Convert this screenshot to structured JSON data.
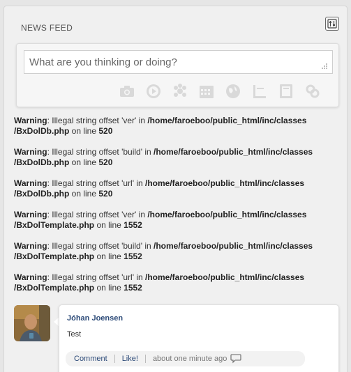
{
  "panel": {
    "title": "NEWS FEED",
    "settings_icon": "panel-settings-icon"
  },
  "composer": {
    "placeholder": "What are you thinking or doing?",
    "tools": [
      "camera-icon",
      "video-icon",
      "sound-icon",
      "calendar-icon",
      "globe-icon",
      "chart-icon",
      "document-icon",
      "link-icon"
    ]
  },
  "warnings": [
    {
      "label": "Warning",
      "pre": ": Illegal string offset 'ver' in ",
      "path": "/home/faroeboo/public_html/inc/classes /BxDolDb.php",
      "mid": " on line ",
      "line": "520"
    },
    {
      "label": "Warning",
      "pre": ": Illegal string offset 'build' in ",
      "path": "/home/faroeboo/public_html/inc/classes /BxDolDb.php",
      "mid": " on line ",
      "line": "520"
    },
    {
      "label": "Warning",
      "pre": ": Illegal string offset 'url' in ",
      "path": "/home/faroeboo/public_html/inc/classes /BxDolDb.php",
      "mid": " on line ",
      "line": "520"
    },
    {
      "label": "Warning",
      "pre": ": Illegal string offset 'ver' in ",
      "path": "/home/faroeboo/public_html/inc/classes /BxDolTemplate.php",
      "mid": " on line ",
      "line": "1552"
    },
    {
      "label": "Warning",
      "pre": ": Illegal string offset 'build' in ",
      "path": "/home/faroeboo/public_html/inc/classes /BxDolTemplate.php",
      "mid": " on line ",
      "line": "1552"
    },
    {
      "label": "Warning",
      "pre": ": Illegal string offset 'url' in ",
      "path": "/home/faroeboo/public_html/inc/classes /BxDolTemplate.php",
      "mid": " on line ",
      "line": "1552"
    }
  ],
  "post": {
    "author": "Jóhan Joensen",
    "text": "Test",
    "comment_label": "Comment",
    "like_label": "Like!",
    "time": "about one minute ago"
  },
  "colors": {
    "link": "#2c4a78",
    "background": "#e6e6e6",
    "panel": "#f0f0f0"
  }
}
